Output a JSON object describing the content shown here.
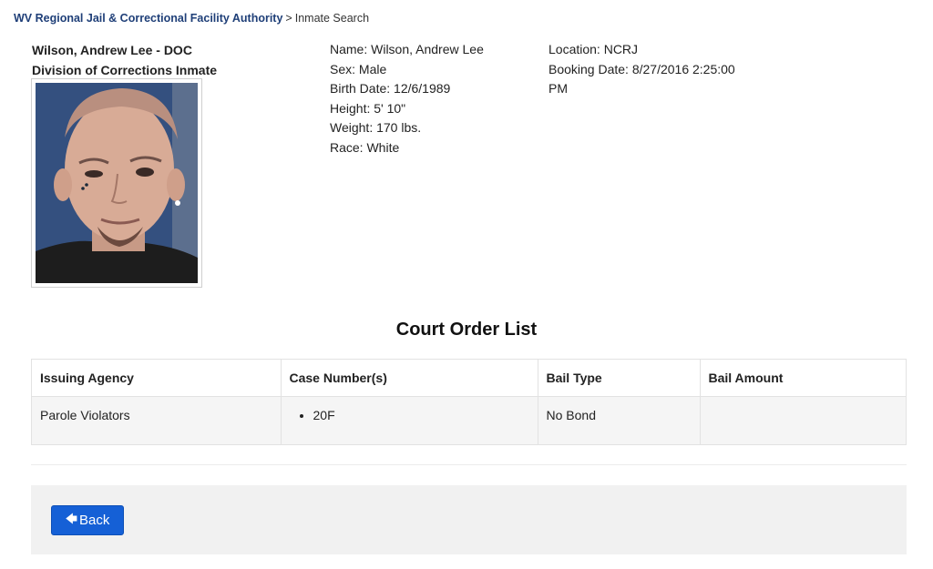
{
  "breadcrumb": {
    "root": "WV Regional Jail & Correctional Facility Authority",
    "separator": ">",
    "current": "Inmate Search"
  },
  "inmate": {
    "title": "Wilson, Andrew Lee - DOC",
    "subtitle": "Division of Corrections Inmate",
    "name": "Name: Wilson, Andrew Lee",
    "sex": "Sex: Male",
    "birth_date": "Birth Date: 12/6/1989",
    "height": "Height: 5' 10\"",
    "weight": "Weight: 170 lbs.",
    "race": "Race: White",
    "location": "Location: NCRJ",
    "booking_date": "Booking Date: 8/27/2016 2:25:00 PM"
  },
  "court_orders": {
    "title": "Court Order List",
    "headers": [
      "Issuing Agency",
      "Case Number(s)",
      "Bail Type",
      "Bail Amount"
    ],
    "rows": [
      {
        "agency": "Parole Violators",
        "case_number": "20F",
        "bail_type": "No Bond",
        "bail_amount": ""
      }
    ]
  },
  "footer": {
    "back_arrow_icon": "arrow-left-icon",
    "back_label": "Back"
  },
  "colors": {
    "link": "#1f3f78",
    "button": "#1560d6",
    "footer_bg": "#f1f1f1",
    "row_bg": "#f5f5f5"
  }
}
